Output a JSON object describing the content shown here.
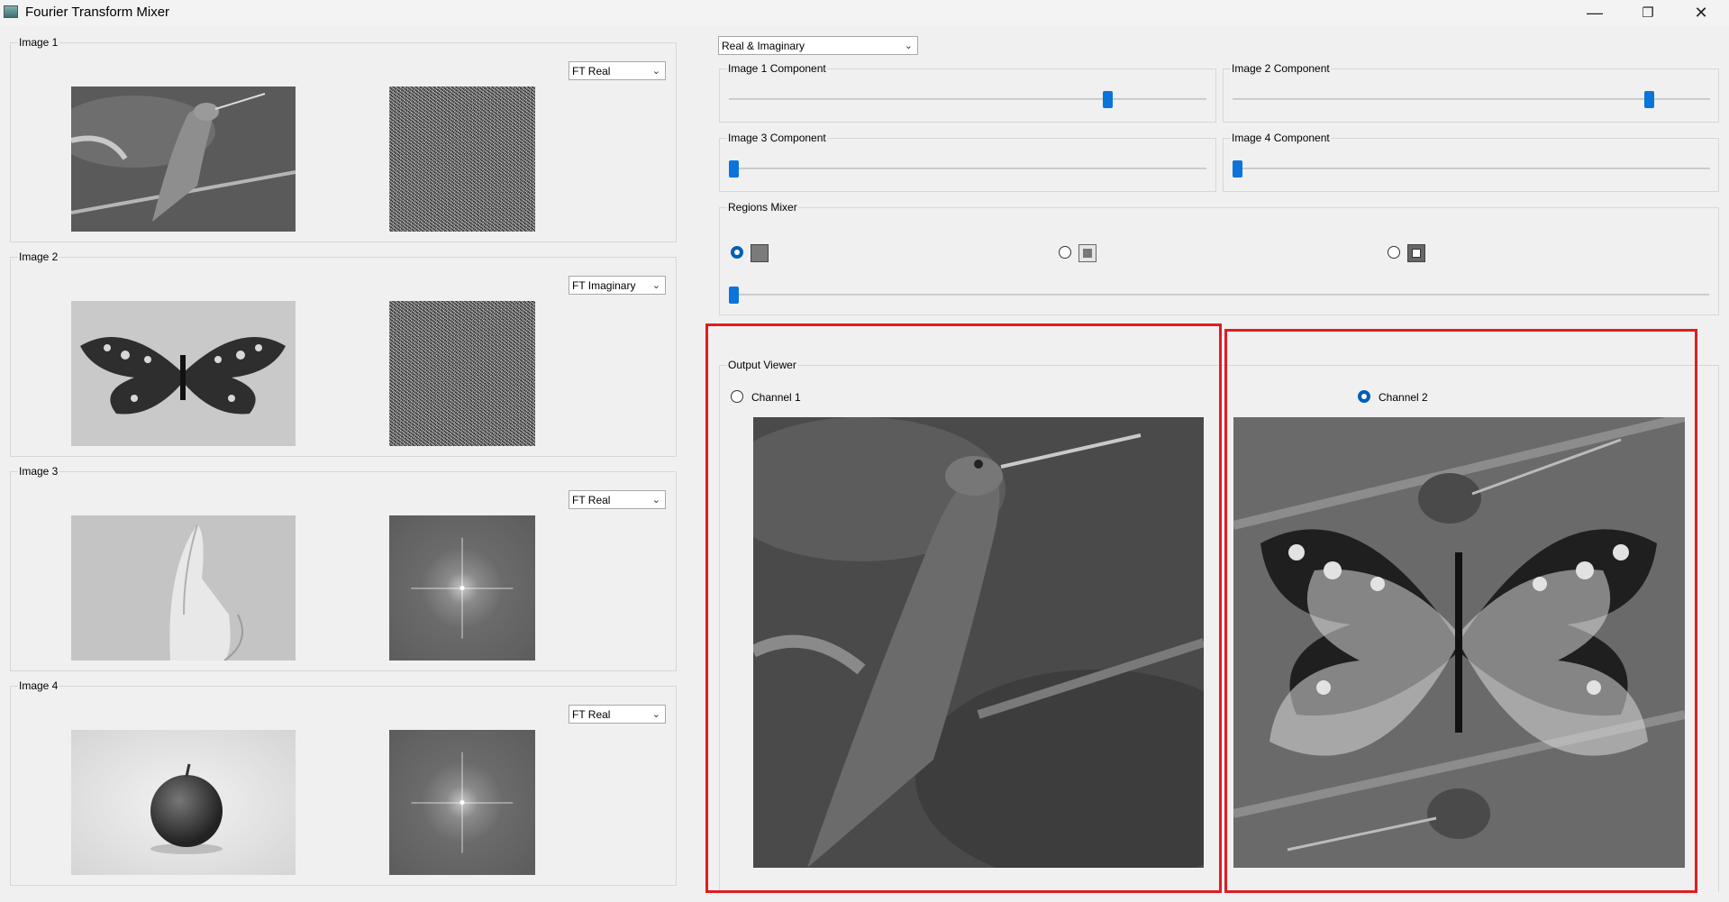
{
  "window": {
    "title": "Fourier Transform Mixer",
    "controls": [
      "—",
      "❐",
      "✕"
    ]
  },
  "inputs": [
    {
      "group_title": "Image 1",
      "component": "FT Real",
      "subject": "hummingbird",
      "ft_style": "noise"
    },
    {
      "group_title": "Image 2",
      "component": "FT Imaginary",
      "subject": "butterfly",
      "ft_style": "noise"
    },
    {
      "group_title": "Image 3",
      "component": "FT Real",
      "subject": "banana",
      "ft_style": "spectrum"
    },
    {
      "group_title": "Image 4",
      "component": "FT Real",
      "subject": "apple",
      "ft_style": "spectrum"
    }
  ],
  "mixer": {
    "mode": "Real & Imaginary",
    "sliders": [
      {
        "title": "Image 1 Component",
        "value": 0.8
      },
      {
        "title": "Image 2 Component",
        "value": 0.88
      },
      {
        "title": "Image 3 Component",
        "value": 0.0
      },
      {
        "title": "Image 4 Component",
        "value": 0.0
      }
    ]
  },
  "regions": {
    "title": "Regions Mixer",
    "options": [
      {
        "icon": "full-square-icon",
        "selected": true
      },
      {
        "icon": "inner-square-icon",
        "selected": false
      },
      {
        "icon": "outer-square-icon",
        "selected": false
      }
    ],
    "slider_value": 0.0
  },
  "output": {
    "title": "Output Viewer",
    "channels": [
      {
        "label": "Channel 1",
        "selected": false
      },
      {
        "label": "Channel 2",
        "selected": true
      }
    ]
  },
  "colors": {
    "accent": "#0a74da",
    "highlight": "#e21b22"
  }
}
